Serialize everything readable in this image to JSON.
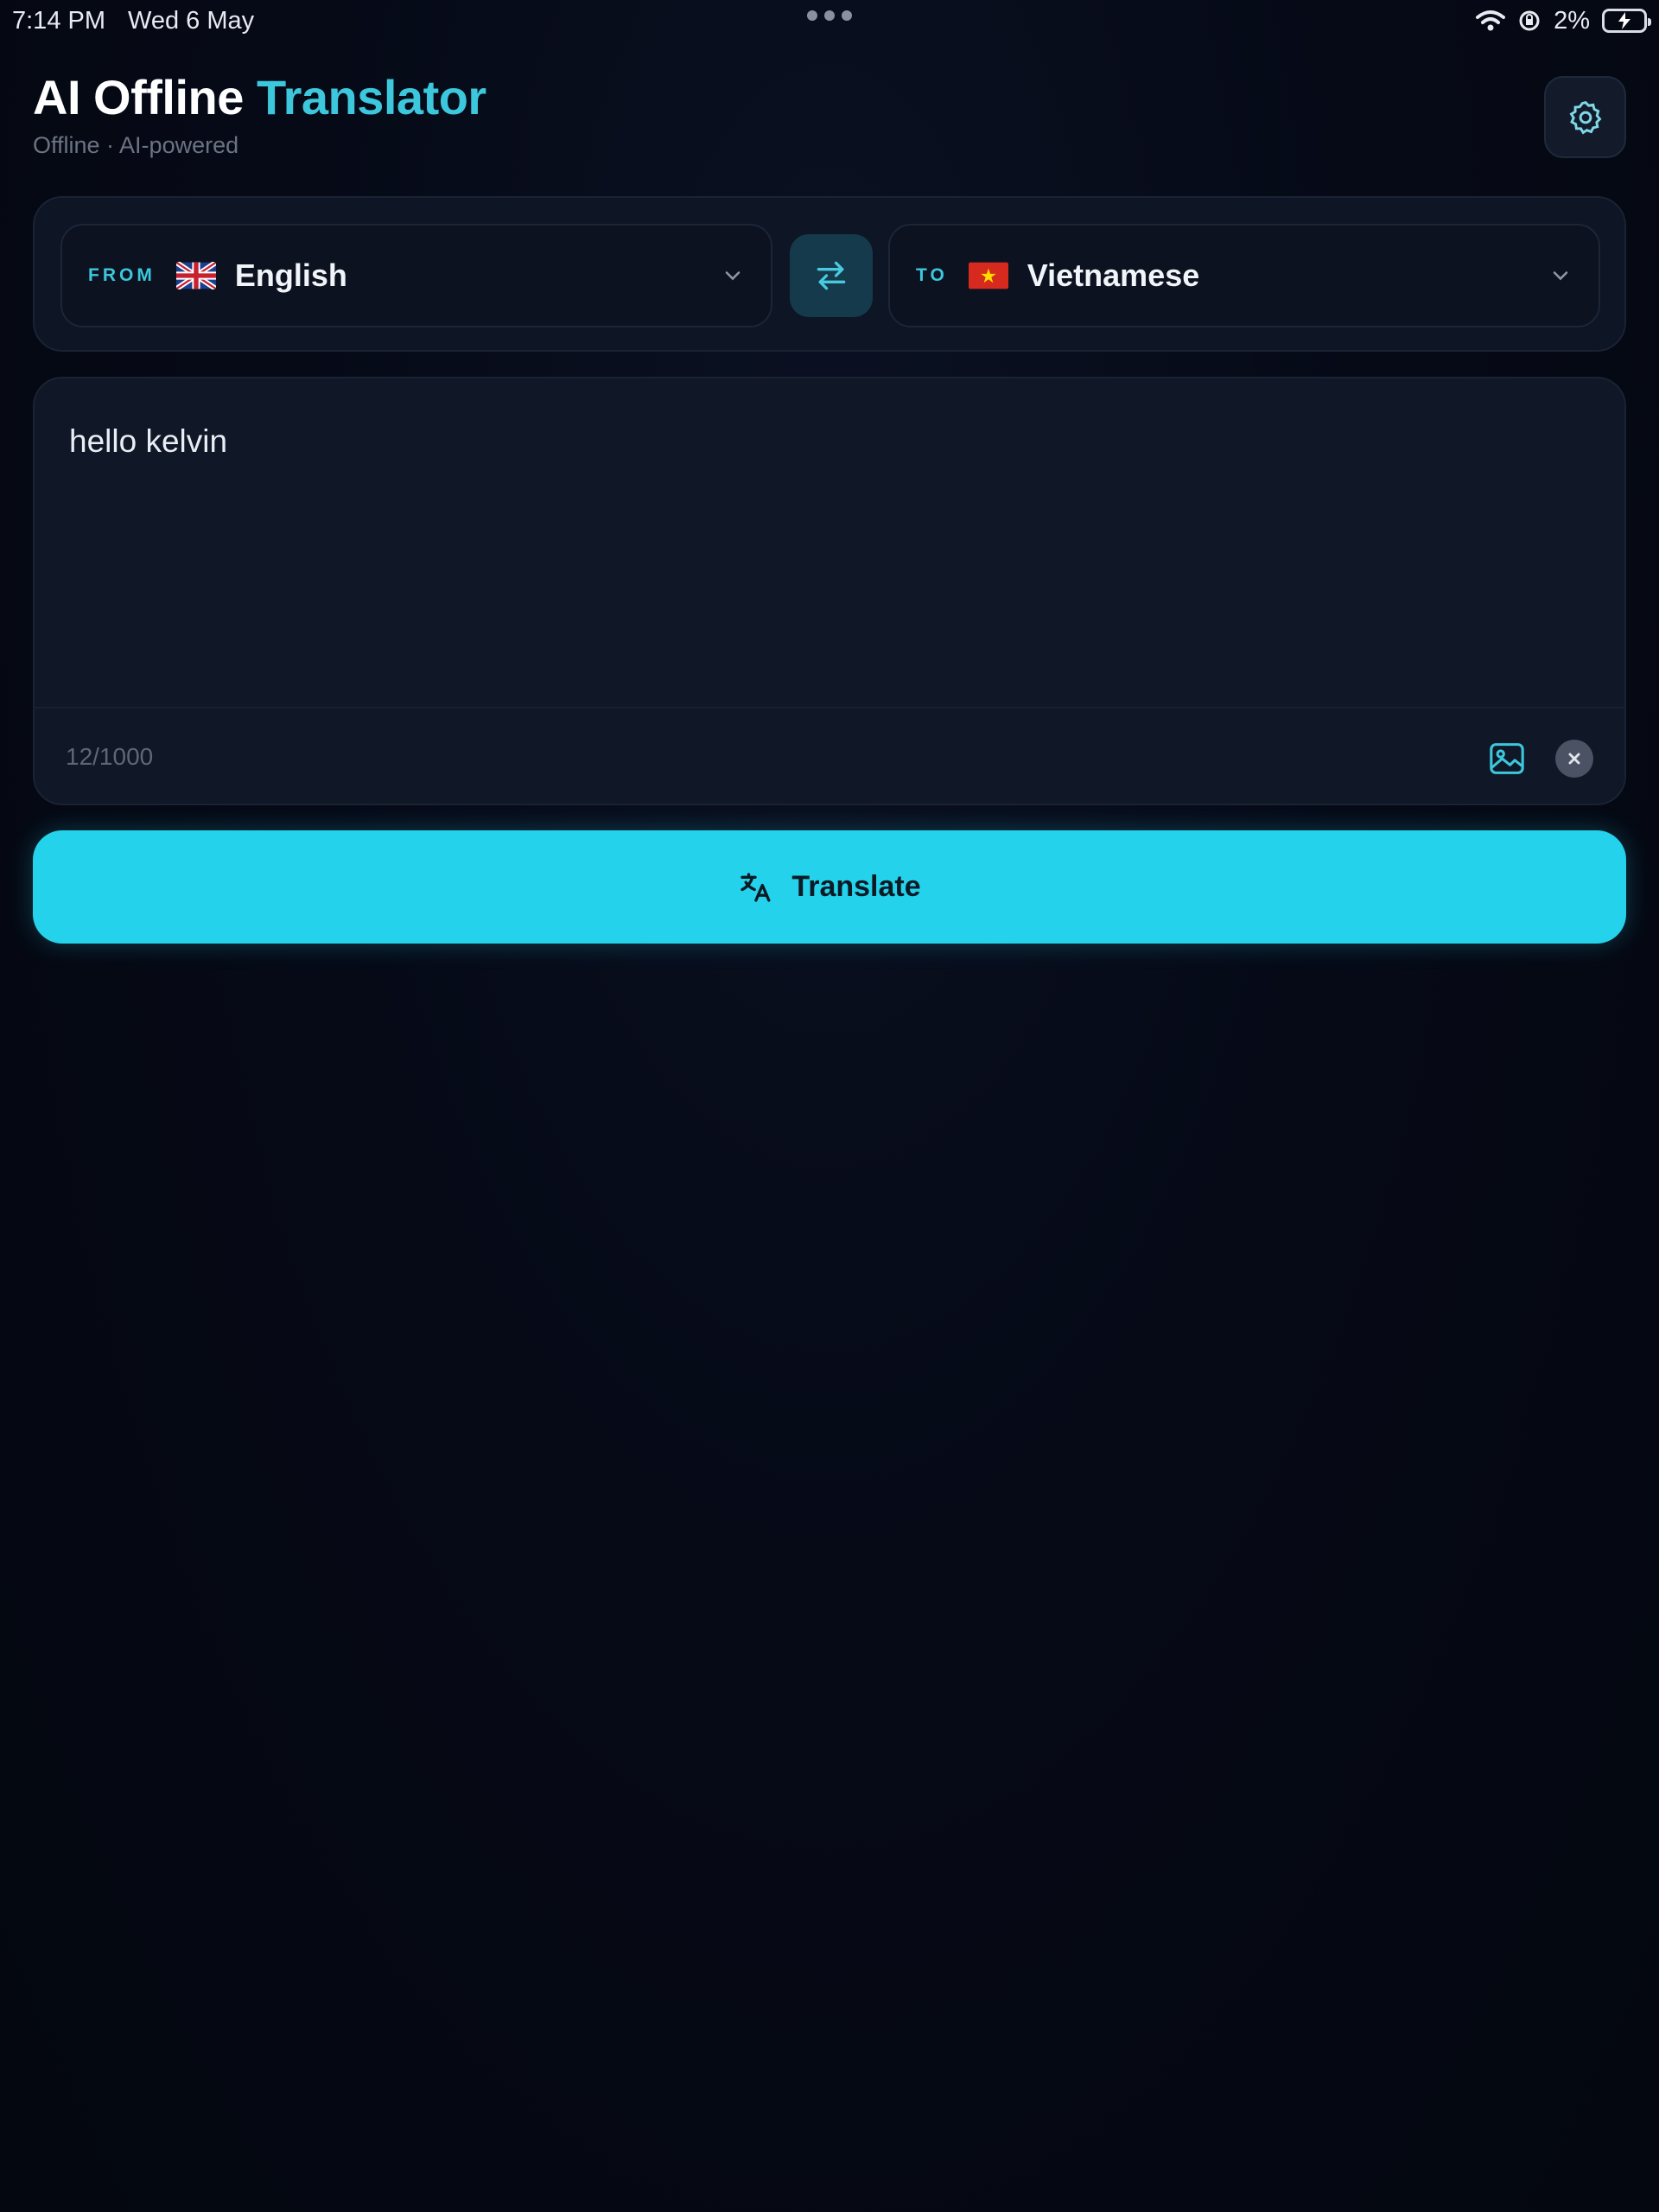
{
  "status_bar": {
    "time": "7:14 PM",
    "date": "Wed 6 May",
    "battery": "2%",
    "icons": [
      "wifi-icon",
      "location-lock-icon",
      "battery-charging-icon"
    ]
  },
  "header": {
    "title_part1": "AI Offline ",
    "title_part2": "Translator",
    "subtitle": "Offline · AI-powered",
    "settings_icon": "gear-icon"
  },
  "languages": {
    "from_tag": "FROM",
    "from_name": "English",
    "from_flag": "uk-flag-icon",
    "to_tag": "TO",
    "to_name": "Vietnamese",
    "to_flag": "vietnam-flag-icon",
    "swap_icon": "swap-arrows-icon"
  },
  "input": {
    "text": "hello kelvin",
    "char_count": "12/1000",
    "image_icon": "image-scan-icon",
    "clear_icon": "close-icon"
  },
  "translate_button": {
    "label": "Translate",
    "icon": "translate-icon"
  },
  "colors": {
    "accent": "#3cc7dd",
    "button": "#25d2ec",
    "background": "#050914"
  }
}
